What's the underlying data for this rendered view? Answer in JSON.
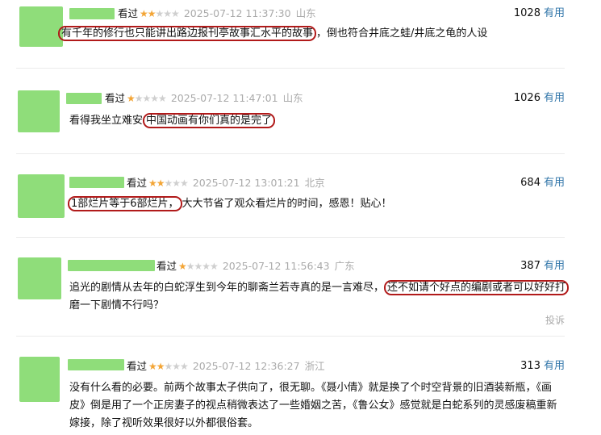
{
  "comments": [
    {
      "status": "看过",
      "rating": 2,
      "time": "2025-07-12 11:37:30",
      "location": "山东",
      "votes": "1028",
      "useful_label": "有用",
      "content_highlight": "有千年的修行也只能讲出路边报刊亭故事汇水平的故事",
      "content_rest": "，倒也符合井底之蛙/井底之龟的人设"
    },
    {
      "status": "看过",
      "rating": 1,
      "time": "2025-07-12 11:47:01",
      "location": "山东",
      "votes": "1026",
      "useful_label": "有用",
      "content_pre": "看得我坐立难安",
      "content_highlight": "中国动画有你们真的是完了"
    },
    {
      "status": "看过",
      "rating": 2,
      "time": "2025-07-12 13:01:21",
      "location": "北京",
      "votes": "684",
      "useful_label": "有用",
      "content_highlight": "1部烂片等于6部烂片，",
      "content_rest": "大大节省了观众看烂片的时间，感恩！贴心！"
    },
    {
      "status": "看过",
      "rating": 1,
      "time": "2025-07-12 11:56:43",
      "location": "广东",
      "votes": "387",
      "useful_label": "有用",
      "content_pre": "追光的剧情从去年的白蛇浮生到今年的聊斋兰若寺真的是一言难尽，",
      "content_highlight": "还不如请个好点的编剧或者可以好好打",
      "content_line2": "磨一下剧情不行吗？",
      "report_label": "投诉"
    },
    {
      "status": "看过",
      "rating": 2,
      "time": "2025-07-12 12:36:27",
      "location": "浙江",
      "votes": "313",
      "useful_label": "有用",
      "content_line1": "没有什么看的必要。前两个故事太子供向了，很无聊。《聂小倩》就是换了个时空背景的旧酒装新瓶，《画",
      "content_line2": "皮》倒是用了一个正房妻子的视点稍微表达了一些婚姻之苦，《鲁公女》感觉就是白蛇系列的灵感废稿重新",
      "content_line3": "嫁接，除了视听效果很好以外都很俗套。"
    }
  ],
  "colors": {
    "avatar_placeholder": "#8fdd7a",
    "star_on": "#f3a536",
    "star_off": "#cfcfcf",
    "useful_link": "#3377aa",
    "highlight_border": "#b11a1a"
  }
}
